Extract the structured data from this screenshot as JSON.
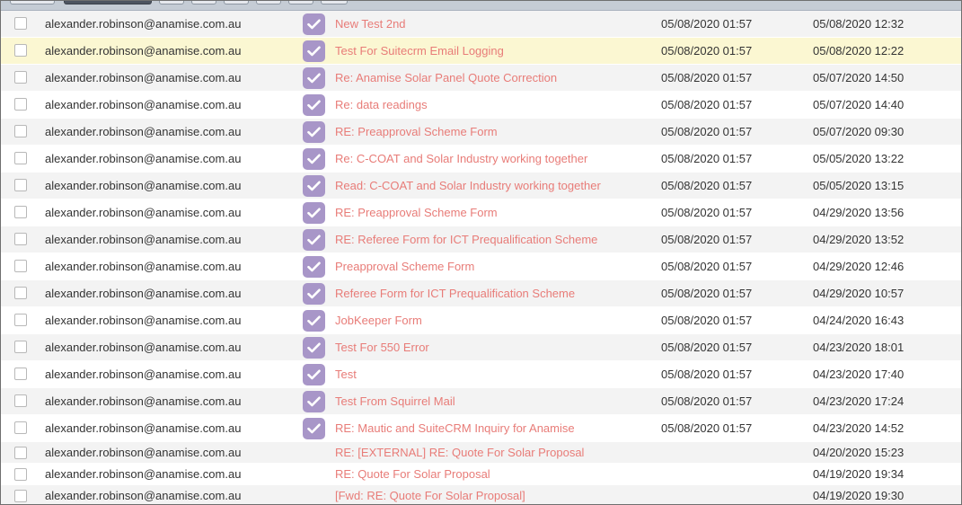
{
  "colors": {
    "subject_link": "#e87c78",
    "imported_badge": "#a896c8",
    "row_highlight": "#fbf7d2",
    "row_alt": "#f3f3f3"
  },
  "icons": {
    "imported": "check-icon"
  },
  "emails": [
    {
      "from": "alexander.robinson@anamise.com.au",
      "subject": "New Test 2nd",
      "imported": true,
      "imported_date": "05/08/2020 01:57",
      "date": "05/08/2020 12:32"
    },
    {
      "from": "alexander.robinson@anamise.com.au",
      "subject": "Test For Suitecrm Email Logging",
      "imported": true,
      "imported_date": "05/08/2020 01:57",
      "date": "05/08/2020 12:22",
      "highlighted": true
    },
    {
      "from": "alexander.robinson@anamise.com.au",
      "subject": "Re: Anamise Solar Panel Quote Correction",
      "imported": true,
      "imported_date": "05/08/2020 01:57",
      "date": "05/07/2020 14:50"
    },
    {
      "from": "alexander.robinson@anamise.com.au",
      "subject": "Re: data readings",
      "imported": true,
      "imported_date": "05/08/2020 01:57",
      "date": "05/07/2020 14:40"
    },
    {
      "from": "alexander.robinson@anamise.com.au",
      "subject": "RE: Preapproval Scheme Form",
      "imported": true,
      "imported_date": "05/08/2020 01:57",
      "date": "05/07/2020 09:30"
    },
    {
      "from": "alexander.robinson@anamise.com.au",
      "subject": "Re: C-COAT and Solar Industry working together",
      "imported": true,
      "imported_date": "05/08/2020 01:57",
      "date": "05/05/2020 13:22"
    },
    {
      "from": "alexander.robinson@anamise.com.au",
      "subject": "Read: C-COAT and Solar Industry working together",
      "imported": true,
      "imported_date": "05/08/2020 01:57",
      "date": "05/05/2020 13:15"
    },
    {
      "from": "alexander.robinson@anamise.com.au",
      "subject": "RE: Preapproval Scheme Form",
      "imported": true,
      "imported_date": "05/08/2020 01:57",
      "date": "04/29/2020 13:56"
    },
    {
      "from": "alexander.robinson@anamise.com.au",
      "subject": "RE: Referee Form for ICT Prequalification Scheme",
      "imported": true,
      "imported_date": "05/08/2020 01:57",
      "date": "04/29/2020 13:52"
    },
    {
      "from": "alexander.robinson@anamise.com.au",
      "subject": "Preapproval Scheme Form",
      "imported": true,
      "imported_date": "05/08/2020 01:57",
      "date": "04/29/2020 12:46"
    },
    {
      "from": "alexander.robinson@anamise.com.au",
      "subject": "Referee Form for ICT Prequalification Scheme",
      "imported": true,
      "imported_date": "05/08/2020 01:57",
      "date": "04/29/2020 10:57"
    },
    {
      "from": "alexander.robinson@anamise.com.au",
      "subject": "JobKeeper Form",
      "imported": true,
      "imported_date": "05/08/2020 01:57",
      "date": "04/24/2020 16:43"
    },
    {
      "from": "alexander.robinson@anamise.com.au",
      "subject": "Test For 550 Error",
      "imported": true,
      "imported_date": "05/08/2020 01:57",
      "date": "04/23/2020 18:01"
    },
    {
      "from": "alexander.robinson@anamise.com.au",
      "subject": "Test",
      "imported": true,
      "imported_date": "05/08/2020 01:57",
      "date": "04/23/2020 17:40"
    },
    {
      "from": "alexander.robinson@anamise.com.au",
      "subject": "Test From Squirrel Mail",
      "imported": true,
      "imported_date": "05/08/2020 01:57",
      "date": "04/23/2020 17:24"
    },
    {
      "from": "alexander.robinson@anamise.com.au",
      "subject": "RE: Mautic and SuiteCRM Inquiry for Anamise",
      "imported": true,
      "imported_date": "05/08/2020 01:57",
      "date": "04/23/2020 14:52"
    },
    {
      "from": "alexander.robinson@anamise.com.au",
      "subject": "RE: [EXTERNAL] RE: Quote For Solar Proposal",
      "imported": false,
      "imported_date": "",
      "date": "04/20/2020 15:23"
    },
    {
      "from": "alexander.robinson@anamise.com.au",
      "subject": "RE: Quote For Solar Proposal",
      "imported": false,
      "imported_date": "",
      "date": "04/19/2020 19:34"
    },
    {
      "from": "alexander.robinson@anamise.com.au",
      "subject": "[Fwd: RE: Quote For Solar Proposal]",
      "imported": false,
      "imported_date": "",
      "date": "04/19/2020 19:30"
    }
  ]
}
